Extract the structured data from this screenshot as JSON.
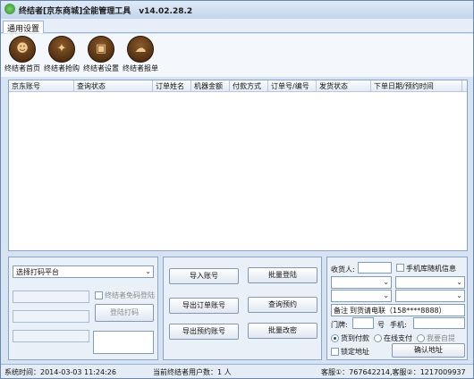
{
  "window": {
    "title": "终结者[京东商城]全能管理工具　v14.02.28.2"
  },
  "tabs": [
    "通用设置"
  ],
  "toolbar": [
    {
      "label": "终结者首页",
      "icon": "home-icon"
    },
    {
      "label": "终结者抢购",
      "icon": "team-icon"
    },
    {
      "label": "终结者设置",
      "icon": "settings-icon"
    },
    {
      "label": "终结者报单",
      "icon": "cloud-icon"
    }
  ],
  "grid": {
    "columns": [
      "京东账号",
      "查询状态",
      "订单姓名",
      "机器金额",
      "付款方式",
      "订单号/编号",
      "发货状态",
      "下单日期/预约时间"
    ]
  },
  "left_panel": {
    "printer_select": "选择打码平台",
    "auto_login_label": "终结者免码登陆",
    "login_button": "登陆打码"
  },
  "middle_panel": {
    "import_account": "导入账号",
    "batch_login": "批量登陆",
    "export_order_account": "导出订单账号",
    "query_reserve": "查询预约",
    "export_reserve_account": "导出预约账号",
    "batch_modify": "批量改密"
  },
  "right_panel": {
    "consignee_label": "收货人:",
    "random_phone_label": "手机库随机信息",
    "remark_label": "备注",
    "remark_value": "到货请电联（158****8888）",
    "door_label": "门牌:",
    "number_label": "号",
    "phone_label": "手机:",
    "pay_on_delivery": "货到付款",
    "online_pay": "在线支付",
    "company_self": "我要自提",
    "lock_address": "锁定地址",
    "confirm_address": "确认地址"
  },
  "status": {
    "system_time": "系统时间：2014-03-03 11:24:26",
    "current_users": "当前终结者用户数：1 人",
    "service": "客服①：767642214,客服②：1217009937"
  }
}
